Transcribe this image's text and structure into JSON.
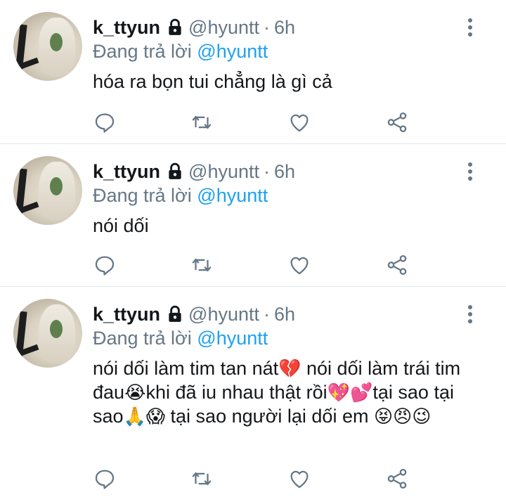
{
  "tweets": [
    {
      "name": "k_ttyun",
      "handle": "@hyuntt",
      "separator": "·",
      "time": "6h",
      "reply_prefix": "Đang trả lời",
      "reply_mention": "@hyuntt",
      "text": "hóa ra bọn tui chẳng là gì cả"
    },
    {
      "name": "k_ttyun",
      "handle": "@hyuntt",
      "separator": "·",
      "time": "6h",
      "reply_prefix": "Đang trả lời",
      "reply_mention": "@hyuntt",
      "text": "nói dối"
    },
    {
      "name": "k_ttyun",
      "handle": "@hyuntt",
      "separator": "·",
      "time": "6h",
      "reply_prefix": "Đang trả lời",
      "reply_mention": "@hyuntt",
      "text_parts": {
        "a": "nói dối làm tim tan nát",
        "e1": "💔",
        "b": " nói dối làm trái tim đau",
        "e2": "😭",
        "c": "khi đã iu nhau thật rồi",
        "e3": "💖",
        "e4": "💕",
        "d": "tại sao tại sao",
        "e5": "🙏",
        "e6": "😱",
        "f": " tại sao người lại dối em",
        "e7": "😝",
        "e8": "😠",
        "e9": "😉"
      }
    }
  ],
  "icons": {
    "lock": "lock-icon",
    "menu": "more-vertical-icon",
    "reply": "reply-icon",
    "retweet": "retweet-icon",
    "like": "heart-icon",
    "share": "share-icon"
  },
  "colors": {
    "text": "#14171a",
    "muted": "#657786",
    "mention": "#1da1f2",
    "divider": "#e1e8ed"
  }
}
